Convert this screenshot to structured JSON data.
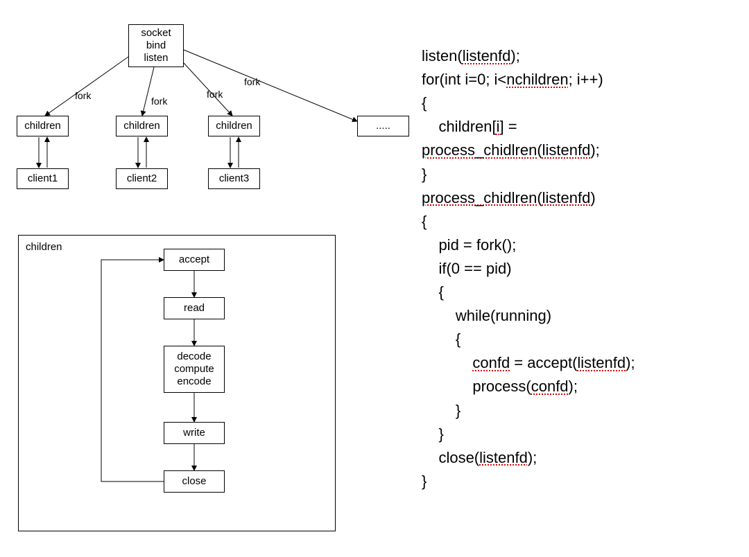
{
  "top": {
    "root": {
      "l1": "socket",
      "l2": "bind",
      "l3": "listen"
    },
    "forks": [
      "fork",
      "fork",
      "fork",
      "fork"
    ],
    "children": [
      "children",
      "children",
      "children"
    ],
    "clients": [
      "client1",
      "client2",
      "client3"
    ],
    "ellipsis": "....."
  },
  "flow": {
    "title": "children",
    "steps": [
      "accept",
      "read",
      "decode\ncompute\nencode",
      "write",
      "close"
    ]
  },
  "code": {
    "l1a": "listen(",
    "l1b": "listenfd",
    "l1c": ");",
    "l2a": "for(int i=0; i<",
    "l2b": "nchildren",
    "l2c": "; i++)",
    "l3": "{",
    "l4a": "    children[",
    "l4b": "i",
    "l4c": "] =",
    "l5a": "process_chidlren",
    "l5b": "(",
    "l5c": "listenfd",
    "l5d": ");",
    "l6": "}",
    "l7a": "process_chidlren",
    "l7b": "(",
    "l7c": "listenfd",
    "l7d": ")",
    "l8": "{",
    "l9": "    pid = fork();",
    "l10": "    if(0 == pid)",
    "l11": "    {",
    "l12": "        while(running)",
    "l13": "        {",
    "l14a": "            ",
    "l14b": "confd",
    "l14c": " = accept(",
    "l14d": "listenfd",
    "l14e": ");",
    "l15a": "            process(",
    "l15b": "confd",
    "l15c": ");",
    "l16": "        }",
    "l17": "    }",
    "l18a": "    close(",
    "l18b": "listenfd",
    "l18c": ");",
    "l19": "}"
  }
}
